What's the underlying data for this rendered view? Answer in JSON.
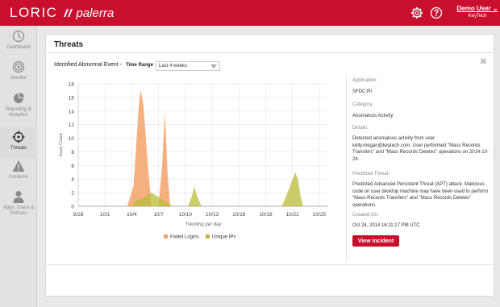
{
  "brand": {
    "logo_left": "LORIC",
    "logo_right": "palerra"
  },
  "header": {
    "settings_icon": "gear-icon",
    "help_icon": "help-icon",
    "user_name": "Demo User",
    "user_org": "KeyTech"
  },
  "sidebar": {
    "items": [
      {
        "label": "Dashboard",
        "icon": "dashboard-icon"
      },
      {
        "label": "Monitor",
        "icon": "monitor-icon"
      },
      {
        "label": "Reporting & Analytics",
        "icon": "pie-chart-icon"
      },
      {
        "label": "Threats",
        "icon": "crosshair-icon",
        "active": true
      },
      {
        "label": "Incidents",
        "icon": "warning-icon"
      },
      {
        "label": "Apps, Users & Policies",
        "icon": "users-icon"
      }
    ]
  },
  "page": {
    "title": "Threats",
    "toolbar_label": "Identified Abnormal Event -",
    "time_range_label": "Time Range",
    "time_range_value": "Last 4 weeks"
  },
  "chart_data": {
    "type": "area",
    "x": [
      "9/28",
      "10/1",
      "10/4",
      "10/7",
      "10/10",
      "10/13",
      "10/16",
      "10/19",
      "10/22",
      "10/25"
    ],
    "xlabel": "Trending per day",
    "ylabel": "Issue Count",
    "ylim": [
      0,
      18
    ],
    "yticks": [
      0,
      2,
      4,
      6,
      8,
      10,
      12,
      14,
      16,
      18
    ],
    "grid": true,
    "legend_position": "bottom",
    "series": [
      {
        "name": "Failed Logins",
        "color": "#f5a26a",
        "points": [
          [
            5.5,
            0
          ],
          [
            6.2,
            3
          ],
          [
            6.8,
            15
          ],
          [
            7.0,
            17
          ],
          [
            7.3,
            15
          ],
          [
            7.8,
            6
          ],
          [
            8.2,
            0
          ],
          [
            9.0,
            0
          ],
          [
            9.4,
            6
          ],
          [
            9.7,
            14
          ],
          [
            10.0,
            5
          ],
          [
            10.3,
            0
          ]
        ]
      },
      {
        "name": "Unique IPs",
        "color": "#b9bc3a",
        "points": [
          [
            6.0,
            0
          ],
          [
            6.5,
            1
          ],
          [
            7.0,
            1
          ],
          [
            7.6,
            1.5
          ],
          [
            8.2,
            2
          ],
          [
            8.8,
            1.5
          ],
          [
            9.4,
            1
          ],
          [
            10.0,
            0.5
          ],
          [
            10.6,
            0
          ],
          [
            12.3,
            0
          ],
          [
            12.8,
            1.8
          ],
          [
            13.0,
            3
          ],
          [
            13.3,
            1.5
          ],
          [
            13.8,
            0
          ],
          [
            22.8,
            0
          ],
          [
            23.6,
            2.5
          ],
          [
            24.3,
            5
          ],
          [
            24.6,
            4
          ],
          [
            24.9,
            1.5
          ],
          [
            25.2,
            0
          ]
        ]
      }
    ]
  },
  "details": {
    "application_label": "Application:",
    "application_value": "SFDC:RI",
    "category_label": "Category:",
    "category_value": "Anomalous Activity",
    "details_label": "Details:",
    "details_value": "Detected anomalous activity from user kelly.megan@keytech.com. User performed \"Mass Records Transfers\" and \"Mass Records Deletes\" operations on 2014-10-24.",
    "threat_label": "Predicted Threat:",
    "threat_value": "Predicted Advanced Persistent Threat (APT) attack. Malicious code on user desktop machine may have been used to perform \"Mass Records Transfers\" and \"Mass Records Deletes\" operations.",
    "created_label": "Created On:",
    "created_value": "Oct 24, 2014 16:11:17 PM UTC",
    "view_button": "View incident"
  }
}
